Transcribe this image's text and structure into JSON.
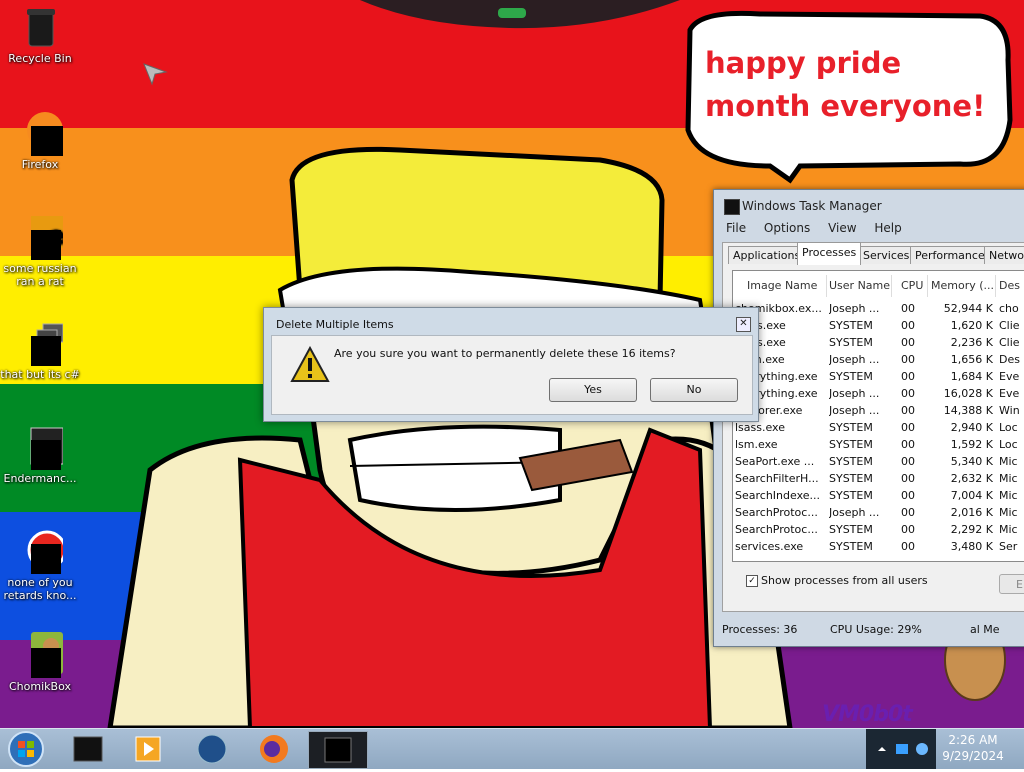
{
  "desktop": {
    "icons": [
      {
        "label": "Recycle Bin"
      },
      {
        "label": "Firefox"
      },
      {
        "label": "some russian ran a rat"
      },
      {
        "label": "that but its c#"
      },
      {
        "label": "Endermanc..."
      },
      {
        "label": "none of you retards kno..."
      },
      {
        "label": "ChomikBox"
      }
    ],
    "bubble_text": "happy pride month everyone!",
    "watermark": "VM0b0t"
  },
  "task_manager": {
    "title": "Windows Task Manager",
    "menu": [
      "File",
      "Options",
      "View",
      "Help"
    ],
    "tabs": [
      "Applications",
      "Processes",
      "Services",
      "Performance",
      "Network"
    ],
    "active_tab": "Processes",
    "columns": [
      "Image Name",
      "User Name",
      "CPU",
      "Memory (...",
      "Des"
    ],
    "rows": [
      [
        "chomikbox.ex...",
        "Joseph ...",
        "00",
        "52,944 K",
        "cho"
      ],
      [
        "csrss.exe",
        "SYSTEM",
        "00",
        "1,620 K",
        "Clie"
      ],
      [
        "csrss.exe",
        "SYSTEM",
        "00",
        "2,236 K",
        "Clie"
      ],
      [
        "dwm.exe",
        "Joseph ...",
        "00",
        "1,656 K",
        "Des"
      ],
      [
        "Everything.exe",
        "SYSTEM",
        "00",
        "1,684 K",
        "Eve"
      ],
      [
        "Everything.exe",
        "Joseph ...",
        "00",
        "16,028 K",
        "Eve"
      ],
      [
        "explorer.exe",
        "Joseph ...",
        "00",
        "14,388 K",
        "Win"
      ],
      [
        "lsass.exe",
        "SYSTEM",
        "00",
        "2,940 K",
        "Loc"
      ],
      [
        "lsm.exe",
        "SYSTEM",
        "00",
        "1,592 K",
        "Loc"
      ],
      [
        "SeaPort.exe ...",
        "SYSTEM",
        "00",
        "5,340 K",
        "Mic"
      ],
      [
        "SearchFilterH...",
        "SYSTEM",
        "00",
        "2,632 K",
        "Mic"
      ],
      [
        "SearchIndexe...",
        "SYSTEM",
        "00",
        "7,004 K",
        "Mic"
      ],
      [
        "SearchProtoc...",
        "Joseph ...",
        "00",
        "2,016 K",
        "Mic"
      ],
      [
        "SearchProtoc...",
        "SYSTEM",
        "00",
        "2,292 K",
        "Mic"
      ],
      [
        "services.exe",
        "SYSTEM",
        "00",
        "3,480 K",
        "Ser"
      ]
    ],
    "show_all_label": "Show processes from all users",
    "end_process_label": "E",
    "status": {
      "processes": "Processes: 36",
      "cpu": "CPU Usage: 29%",
      "memory": "al Me"
    }
  },
  "dialog": {
    "title": "Delete Multiple Items",
    "close_label": "✕",
    "message": "Are you sure you want to permanently delete these 16 items?",
    "yes_label": "Yes",
    "no_label": "No"
  },
  "taskbar": {
    "time": "2:26 AM",
    "date": "9/29/2024"
  }
}
